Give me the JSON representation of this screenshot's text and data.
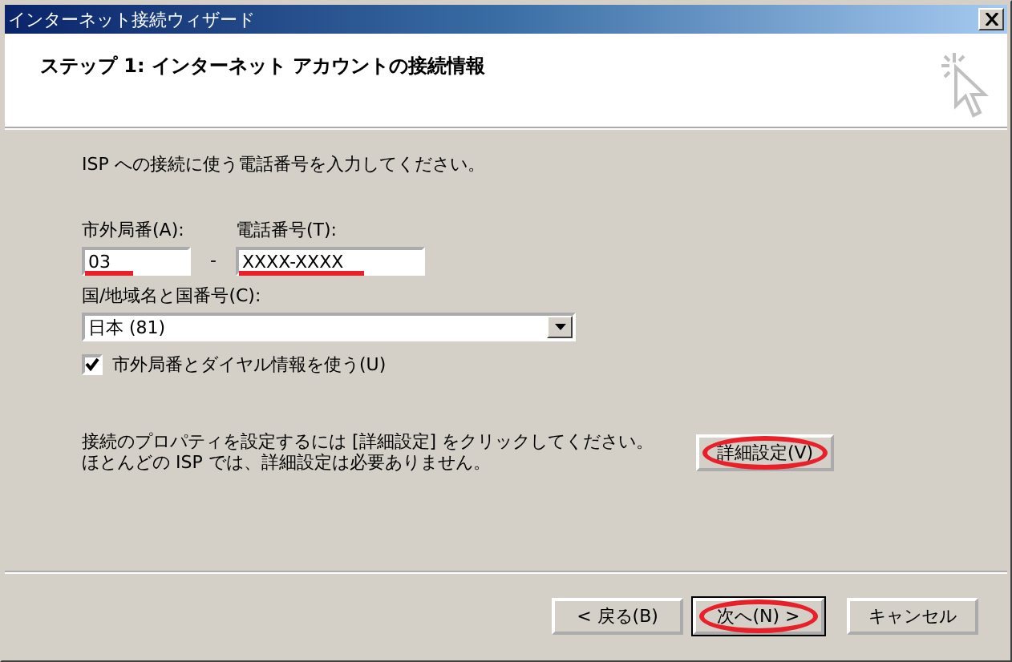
{
  "window": {
    "title": "インターネット接続ウィザード"
  },
  "header": {
    "title": "ステップ 1: インターネット アカウントの接続情報"
  },
  "intro": "ISP への接続に使う電話番号を入力してください。",
  "area_code": {
    "label": "市外局番(A):",
    "value": "03",
    "annotated": true
  },
  "separator": "-",
  "phone": {
    "label": "電話番号(T):",
    "value": "XXXX-XXXX",
    "annotated": true
  },
  "country": {
    "label": "国/地域名と国番号(C):",
    "value": "日本 (81)"
  },
  "use_dialing_rules": {
    "label": "市外局番とダイヤル情報を使う(U)",
    "checked": true
  },
  "advanced_note": [
    "接続のプロパティを設定するには [詳細設定] をクリックしてください。",
    "ほとんどの ISP では、詳細設定は必要ありません。"
  ],
  "advanced_button": {
    "label": "詳細設定(V)",
    "annotated": true
  },
  "buttons": [
    {
      "label": "< 戻る(B)",
      "default": false,
      "annotated": false
    },
    {
      "label": "次へ(N) >",
      "default": true,
      "annotated": true
    },
    {
      "label": "キャンセル",
      "default": false,
      "annotated": false
    }
  ]
}
